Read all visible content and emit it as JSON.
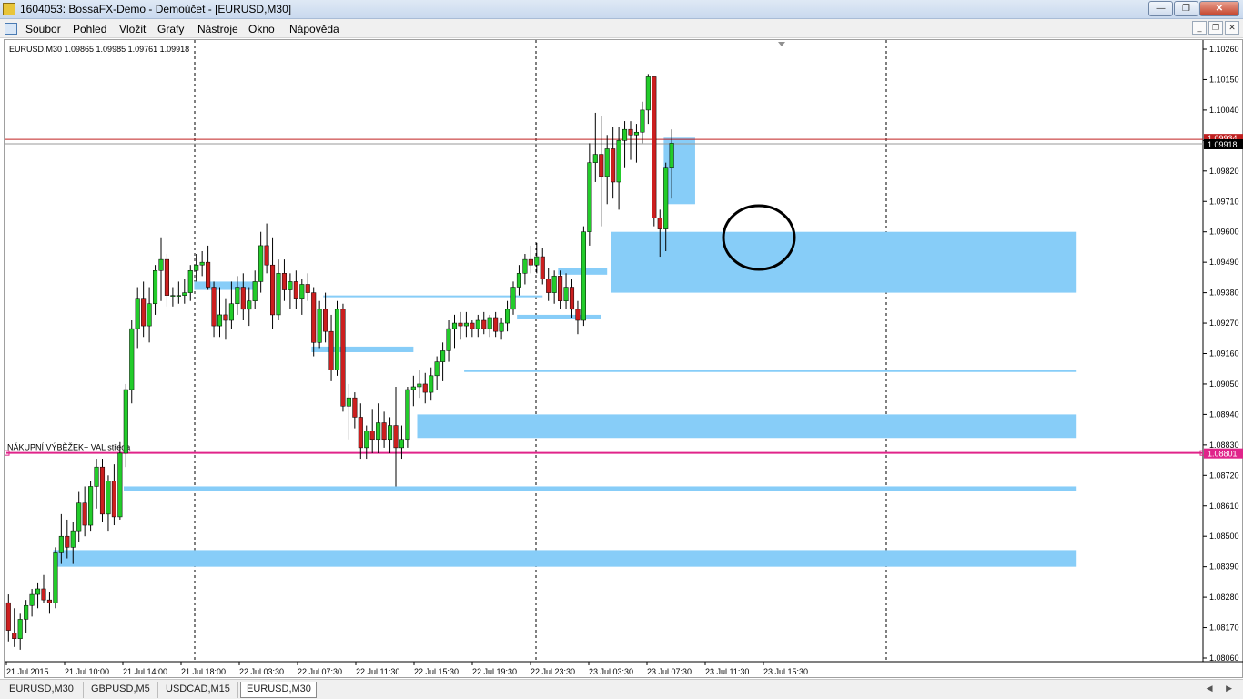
{
  "window": {
    "title": "1604053: BossaFX-Demo - Demoúčet - [EURUSD,M30]",
    "min_glyph": "—",
    "max_glyph": "❐",
    "close_glyph": "✕"
  },
  "menu": {
    "items": [
      "Soubor",
      "Pohled",
      "Vložit",
      "Grafy",
      "Nástroje",
      "Okno",
      "Nápověda"
    ],
    "child_min": "_",
    "child_restore": "❐",
    "child_close": "✕"
  },
  "chart_data": {
    "type": "candlestick",
    "symbol_info": "EURUSD,M30  1.09865 1.09985 1.09761 1.09918",
    "price_axis": {
      "min": 1.0806,
      "max": 1.1026,
      "ticks": [
        "1.10260",
        "1.10150",
        "1.10040",
        "1.09930",
        "1.09820",
        "1.09710",
        "1.09600",
        "1.09490",
        "1.09380",
        "1.09270",
        "1.09160",
        "1.09050",
        "1.08940",
        "1.08830",
        "1.08720",
        "1.08610",
        "1.08500",
        "1.08390",
        "1.08280",
        "1.08170",
        "1.08060"
      ]
    },
    "time_axis": {
      "labels": [
        "21 Jul 2015",
        "21 Jul 10:00",
        "21 Jul 14:00",
        "21 Jul 18:00",
        "22 Jul 03:30",
        "22 Jul 07:30",
        "22 Jul 11:30",
        "22 Jul 15:30",
        "22 Jul 19:30",
        "22 Jul 23:30",
        "23 Jul 03:30",
        "23 Jul 07:30",
        "23 Jul 11:30",
        "23 Jul 15:30"
      ]
    },
    "current_price": "1.09918",
    "bid_line_label": "1.09934",
    "hline": {
      "price": 1.08801,
      "label": "1.08801",
      "text": "NÁKUPNÍ VÝBĚŽEK+ VAL středa",
      "color": "#e0248a"
    },
    "zones": [
      {
        "from_bar": 8,
        "to_bar": 182,
        "top": 1.0845,
        "bottom": 1.0839
      },
      {
        "from_bar": 20,
        "to_bar": 182,
        "top": 1.0868,
        "bottom": 1.08665
      },
      {
        "from_bar": 70,
        "to_bar": 182,
        "top": 1.0894,
        "bottom": 1.08855
      },
      {
        "from_bar": 78,
        "to_bar": 182,
        "top": 1.091,
        "bottom": 1.09095
      },
      {
        "from_bar": 52,
        "to_bar": 69,
        "top": 1.09185,
        "bottom": 1.09165
      },
      {
        "from_bar": 87,
        "to_bar": 101,
        "top": 1.093,
        "bottom": 1.09285
      },
      {
        "from_bar": 54,
        "to_bar": 91,
        "top": 1.0937,
        "bottom": 1.09365
      },
      {
        "from_bar": 103,
        "to_bar": 182,
        "top": 1.096,
        "bottom": 1.0938
      },
      {
        "from_bar": 94,
        "to_bar": 102,
        "top": 1.0947,
        "bottom": 1.09445
      },
      {
        "from_bar": 32,
        "to_bar": 42,
        "top": 1.0942,
        "bottom": 1.0939
      },
      {
        "from_bar": 112,
        "to_bar": 117,
        "top": 1.0994,
        "bottom": 1.097
      }
    ],
    "ohlc": [
      [
        1.0826,
        1.0829,
        1.0812,
        1.0816
      ],
      [
        1.0815,
        1.0824,
        1.081,
        1.0813
      ],
      [
        1.0813,
        1.0822,
        1.0809,
        1.082
      ],
      [
        1.082,
        1.0827,
        1.0815,
        1.0825
      ],
      [
        1.0825,
        1.0831,
        1.0821,
        1.0829
      ],
      [
        1.0829,
        1.0833,
        1.0824,
        1.0831
      ],
      [
        1.0831,
        1.0836,
        1.0826,
        1.0827
      ],
      [
        1.0827,
        1.083,
        1.0822,
        1.0826
      ],
      [
        1.0826,
        1.0846,
        1.0824,
        1.0844
      ],
      [
        1.0844,
        1.0858,
        1.084,
        1.085
      ],
      [
        1.085,
        1.0856,
        1.0842,
        1.0846
      ],
      [
        1.0846,
        1.0855,
        1.084,
        1.0852
      ],
      [
        1.0852,
        1.0866,
        1.0848,
        1.0862
      ],
      [
        1.0862,
        1.0868,
        1.085,
        1.0854
      ],
      [
        1.0854,
        1.087,
        1.0852,
        1.0868
      ],
      [
        1.0868,
        1.0878,
        1.086,
        1.0875
      ],
      [
        1.0875,
        1.0878,
        1.0855,
        1.0858
      ],
      [
        1.0858,
        1.0872,
        1.0852,
        1.087
      ],
      [
        1.087,
        1.0876,
        1.0854,
        1.0857
      ],
      [
        1.0857,
        1.0884,
        1.0856,
        1.088
      ],
      [
        1.088,
        1.0905,
        1.0875,
        1.0903
      ],
      [
        1.0903,
        1.0928,
        1.0898,
        1.0925
      ],
      [
        1.0925,
        1.094,
        1.0918,
        1.0936
      ],
      [
        1.0936,
        1.0942,
        1.0922,
        1.0926
      ],
      [
        1.0926,
        1.094,
        1.092,
        1.0934
      ],
      [
        1.0934,
        1.0948,
        1.093,
        1.0946
      ],
      [
        1.0946,
        1.0958,
        1.0935,
        1.095
      ],
      [
        1.095,
        1.0952,
        1.0933,
        1.0937
      ],
      [
        1.0937,
        1.094,
        1.0933,
        1.0937
      ],
      [
        1.0937,
        1.0942,
        1.0934,
        1.0937
      ],
      [
        1.0937,
        1.0943,
        1.0934,
        1.0938
      ],
      [
        1.0938,
        1.0948,
        1.0935,
        1.0946
      ],
      [
        1.0946,
        1.0952,
        1.0942,
        1.0948
      ],
      [
        1.0948,
        1.0953,
        1.0944,
        1.0949
      ],
      [
        1.0949,
        1.0955,
        1.0939,
        1.094
      ],
      [
        1.094,
        1.0942,
        1.0922,
        1.0926
      ],
      [
        1.0926,
        1.094,
        1.0922,
        1.093
      ],
      [
        1.093,
        1.0936,
        1.0921,
        1.0928
      ],
      [
        1.0928,
        1.0942,
        1.0925,
        1.0934
      ],
      [
        1.0934,
        1.0944,
        1.093,
        1.094
      ],
      [
        1.094,
        1.0945,
        1.0928,
        1.0932
      ],
      [
        1.0932,
        1.094,
        1.0926,
        1.0935
      ],
      [
        1.0935,
        1.0946,
        1.0932,
        1.0942
      ],
      [
        1.0942,
        1.096,
        1.0938,
        1.0955
      ],
      [
        1.0955,
        1.0963,
        1.0945,
        1.0948
      ],
      [
        1.0948,
        1.0958,
        1.0925,
        1.093
      ],
      [
        1.093,
        1.095,
        1.0928,
        1.0945
      ],
      [
        1.0945,
        1.095,
        1.0935,
        1.0939
      ],
      [
        1.0939,
        1.0945,
        1.0932,
        1.0942
      ],
      [
        1.0942,
        1.0946,
        1.0932,
        1.0936
      ],
      [
        1.0936,
        1.0943,
        1.093,
        1.0941
      ],
      [
        1.0941,
        1.0945,
        1.0935,
        1.0938
      ],
      [
        1.0938,
        1.094,
        1.0915,
        1.092
      ],
      [
        1.092,
        1.0935,
        1.0918,
        1.0932
      ],
      [
        1.0932,
        1.0938,
        1.092,
        1.0924
      ],
      [
        1.0924,
        1.093,
        1.0906,
        1.091
      ],
      [
        1.091,
        1.0935,
        1.0908,
        1.0932
      ],
      [
        1.0932,
        1.0934,
        1.0895,
        1.0897
      ],
      [
        1.0897,
        1.0905,
        1.0885,
        1.09
      ],
      [
        1.09,
        1.0902,
        1.0889,
        1.0893
      ],
      [
        1.0893,
        1.0898,
        1.0878,
        1.0882
      ],
      [
        1.0882,
        1.089,
        1.0878,
        1.0888
      ],
      [
        1.0888,
        1.0896,
        1.088,
        1.0885
      ],
      [
        1.0885,
        1.0898,
        1.088,
        1.0891
      ],
      [
        1.0891,
        1.0895,
        1.0882,
        1.0885
      ],
      [
        1.0885,
        1.0893,
        1.088,
        1.089
      ],
      [
        1.089,
        1.0904,
        1.0868,
        1.0882
      ],
      [
        1.0882,
        1.089,
        1.0878,
        1.0885
      ],
      [
        1.0885,
        1.0904,
        1.0882,
        1.0903
      ],
      [
        1.0903,
        1.0908,
        1.0897,
        1.0904
      ],
      [
        1.0904,
        1.091,
        1.09,
        1.0905
      ],
      [
        1.0905,
        1.0909,
        1.0898,
        1.0902
      ],
      [
        1.0902,
        1.0911,
        1.0899,
        1.0908
      ],
      [
        1.0908,
        1.0915,
        1.0903,
        1.0913
      ],
      [
        1.0913,
        1.092,
        1.0906,
        1.0917
      ],
      [
        1.0917,
        1.0928,
        1.0913,
        1.0925
      ],
      [
        1.0925,
        1.093,
        1.0918,
        1.0927
      ],
      [
        1.0927,
        1.0931,
        1.0921,
        1.0926
      ],
      [
        1.0926,
        1.0931,
        1.0922,
        1.0927
      ],
      [
        1.0927,
        1.0928,
        1.0922,
        1.0925
      ],
      [
        1.0925,
        1.093,
        1.0922,
        1.0928
      ],
      [
        1.0928,
        1.0931,
        1.0923,
        1.0925
      ],
      [
        1.0925,
        1.093,
        1.0922,
        1.0929
      ],
      [
        1.0929,
        1.0931,
        1.0922,
        1.0924
      ],
      [
        1.0924,
        1.0929,
        1.0921,
        1.0927
      ],
      [
        1.0927,
        1.0935,
        1.0924,
        1.0932
      ],
      [
        1.0932,
        1.0942,
        1.093,
        1.094
      ],
      [
        1.094,
        1.0948,
        1.0937,
        1.0945
      ],
      [
        1.0945,
        1.0952,
        1.0941,
        1.095
      ],
      [
        1.095,
        1.0955,
        1.0945,
        1.0948
      ],
      [
        1.0948,
        1.0956,
        1.0945,
        1.0951
      ],
      [
        1.0951,
        1.0954,
        1.0941,
        1.0943
      ],
      [
        1.0943,
        1.0947,
        1.0935,
        1.0938
      ],
      [
        1.0938,
        1.0946,
        1.0934,
        1.0944
      ],
      [
        1.0944,
        1.0946,
        1.0932,
        1.0935
      ],
      [
        1.0935,
        1.0945,
        1.0932,
        1.094
      ],
      [
        1.094,
        1.0943,
        1.0929,
        1.0932
      ],
      [
        1.0932,
        1.0935,
        1.0923,
        1.0928
      ],
      [
        1.0928,
        1.0962,
        1.0926,
        1.096
      ],
      [
        1.096,
        1.0992,
        1.0955,
        1.0985
      ],
      [
        1.0985,
        1.1003,
        1.0978,
        1.0988
      ],
      [
        1.0988,
        1.1002,
        1.0962,
        1.098
      ],
      [
        1.098,
        1.0995,
        1.097,
        1.099
      ],
      [
        1.099,
        1.0998,
        1.0972,
        1.0978
      ],
      [
        1.0978,
        1.0998,
        1.0968,
        1.0993
      ],
      [
        1.0993,
        1.1,
        1.0983,
        1.0997
      ],
      [
        1.0997,
        1.1,
        1.0986,
        1.0995
      ],
      [
        1.0995,
        1.0999,
        1.0985,
        1.0996
      ],
      [
        1.0996,
        1.1007,
        1.0992,
        1.1004
      ],
      [
        1.1004,
        1.1017,
        1.0999,
        1.1016
      ],
      [
        1.1016,
        1.1016,
        1.0962,
        1.0965
      ],
      [
        1.0965,
        1.0968,
        1.0951,
        1.0961
      ],
      [
        1.0961,
        1.0985,
        1.0953,
        1.0983
      ],
      [
        1.0983,
        1.0997,
        1.0972,
        1.0992
      ]
    ]
  },
  "tabs": [
    "EURUSD,M30",
    "GBPUSD,M5",
    "USDCAD,M15",
    "EURUSD,M30"
  ],
  "tab_arrows": "◀ ▶"
}
